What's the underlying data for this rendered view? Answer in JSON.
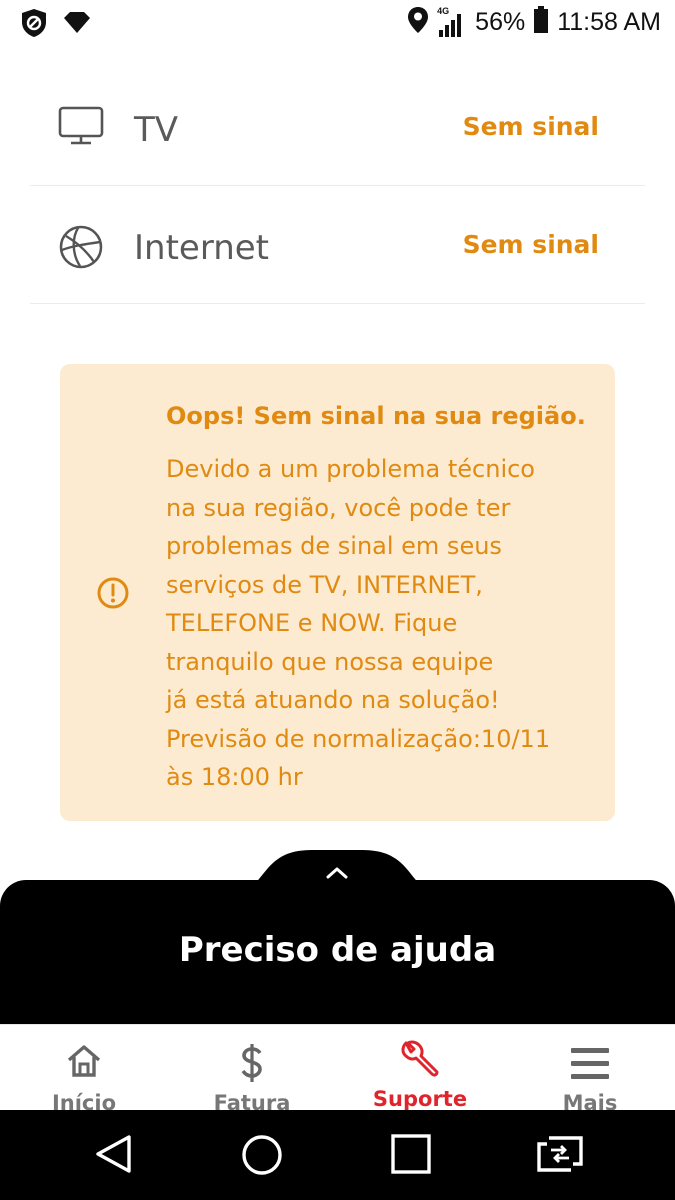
{
  "status_bar": {
    "network_type": "4G",
    "battery": "56%",
    "time": "11:58 AM",
    "icons": [
      "shield-icon",
      "wifi-icon",
      "location-icon",
      "signal-icon",
      "battery-icon"
    ]
  },
  "services": [
    {
      "icon": "tv-icon",
      "label": "TV",
      "status": "Sem sinal"
    },
    {
      "icon": "globe-icon",
      "label": "Internet",
      "status": "Sem sinal"
    }
  ],
  "alert": {
    "icon": "alert-circle-icon",
    "title": "Oops! Sem sinal na sua região.",
    "body_lines": [
      "Devido a um problema técnico",
      "na sua região, você pode ter",
      "problemas de sinal em seus",
      "serviços de TV, INTERNET,",
      "TELEFONE e NOW. Fique",
      "tranquilo que nossa equipe",
      "já está atuando na solução!",
      "Previsão de normalização:10/11",
      "às 18:00 hr"
    ]
  },
  "help_panel": {
    "title": "Preciso de ajuda",
    "icon": "chevron-up-icon"
  },
  "bottom_nav": {
    "items": [
      {
        "icon": "home-icon",
        "label": "Início",
        "active": false
      },
      {
        "icon": "dollar-icon",
        "label": "Fatura",
        "active": false
      },
      {
        "icon": "wrench-icon",
        "label": "Suporte",
        "active": true
      },
      {
        "icon": "menu-icon",
        "label": "Mais",
        "active": false
      }
    ]
  },
  "colors": {
    "accent_orange": "#e08a12",
    "alert_background": "#fcebd0",
    "active_red": "#e0242b",
    "help_panel": "#000000"
  }
}
